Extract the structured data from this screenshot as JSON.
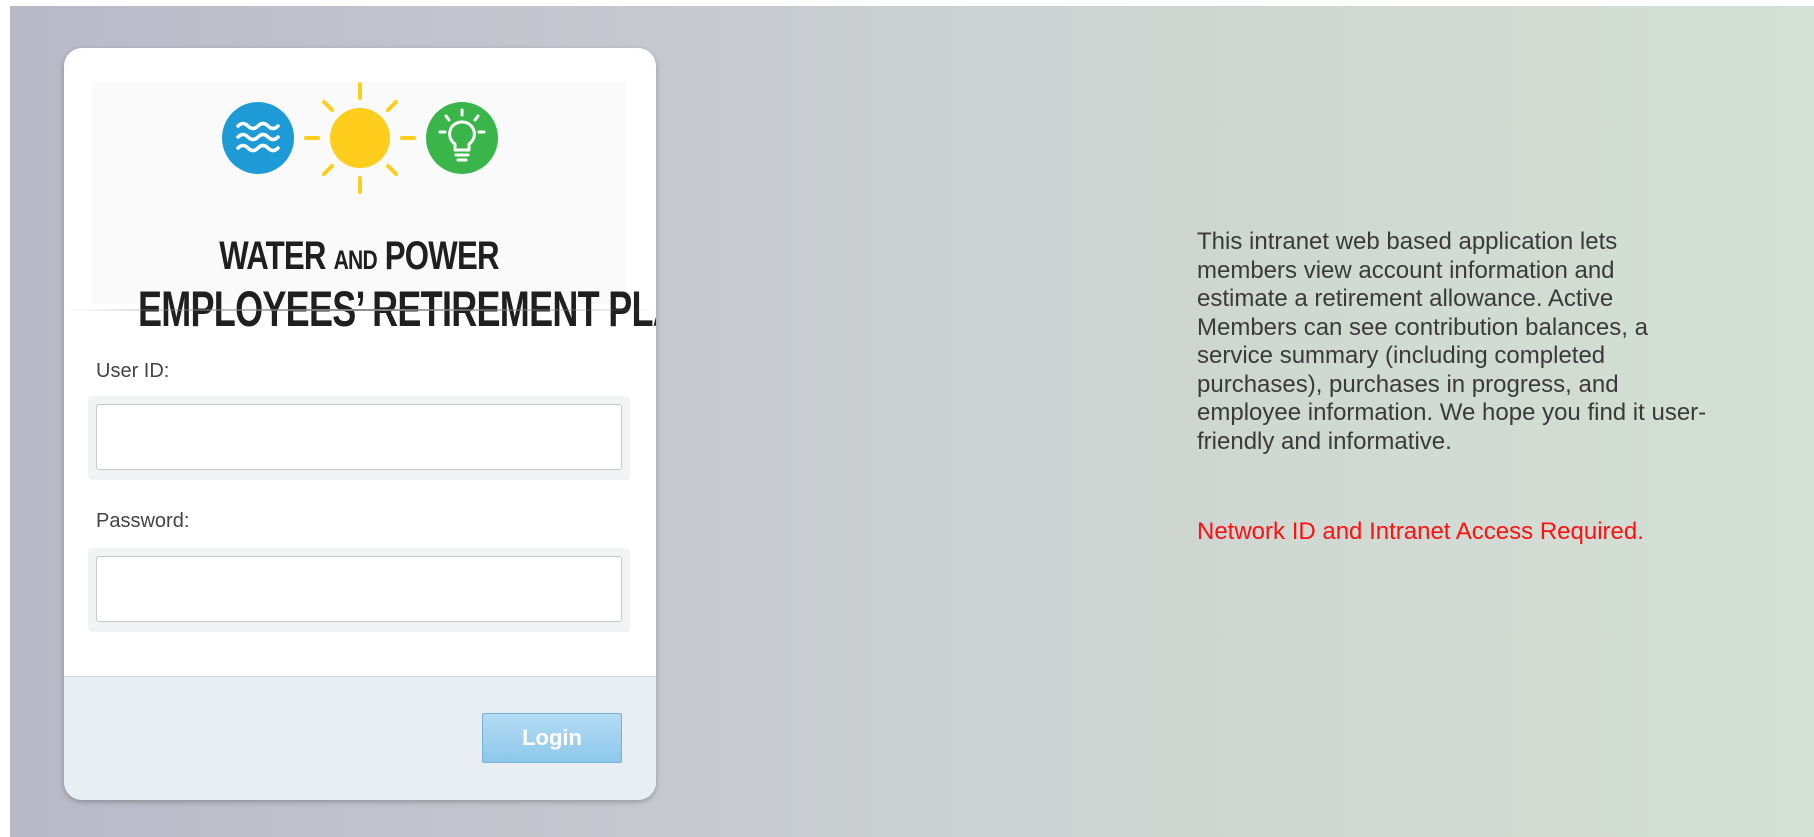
{
  "logo": {
    "line1_main_a": "WATER",
    "line1_small": "AND",
    "line1_main_b": "POWER",
    "line2": "EMPLOYEES’ RETIREMENT PLAN",
    "icons": [
      "water-waves-icon",
      "sun-icon",
      "lightbulb-icon"
    ],
    "colors": {
      "water": "#1e9ad6",
      "sun": "#ffcd1c",
      "lightbulb": "#3ab54a"
    }
  },
  "form": {
    "user_id_label": "User ID:",
    "user_id_value": "",
    "password_label": "Password:",
    "password_value": "",
    "login_label": "Login"
  },
  "info": {
    "description": "This intranet web based application lets\nmembers view account information and\nestimate a retirement allowance. Active\nMembers can see contribution balances, a\nservice summary (including completed\npurchases), purchases in progress, and\nemployee information. We hope you find it user-\nfriendly and informative.",
    "warning": "Network ID and Intranet Access Required.",
    "warning_color": "#ff1010"
  }
}
